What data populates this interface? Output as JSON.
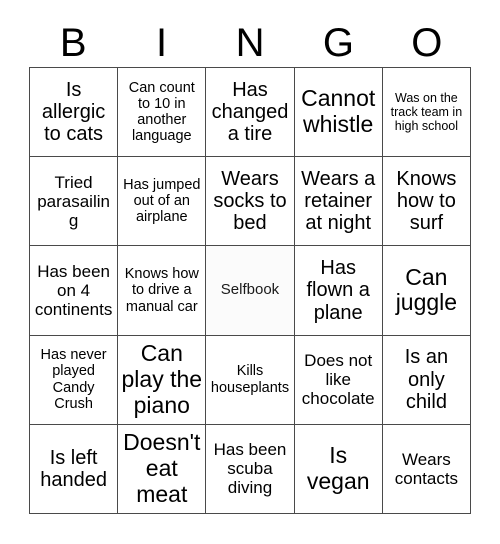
{
  "card": {
    "title": "BINGO",
    "header_letters": [
      "B",
      "I",
      "N",
      "G",
      "O"
    ],
    "grid_size": "5x5",
    "free_space_index": 12,
    "colors": {
      "border": "#4a4a4a",
      "text": "#000000",
      "background": "#ffffff",
      "free_space_background": "#fbfbfb"
    },
    "cells": [
      {
        "text": "Is allergic to cats",
        "size": "lg",
        "free": false
      },
      {
        "text": "Can count to 10 in another language",
        "size": "sm",
        "free": false
      },
      {
        "text": "Has changed a tire",
        "size": "lg",
        "free": false
      },
      {
        "text": "Cannot whistle",
        "size": "xl",
        "free": false
      },
      {
        "text": "Was on the track team in high school",
        "size": "xs",
        "free": false
      },
      {
        "text": "Tried parasailing",
        "size": "md",
        "free": false
      },
      {
        "text": "Has jumped out of an airplane",
        "size": "sm",
        "free": false
      },
      {
        "text": "Wears socks to bed",
        "size": "lg",
        "free": false
      },
      {
        "text": "Wears a retainer at night",
        "size": "lg",
        "free": false
      },
      {
        "text": "Knows how to surf",
        "size": "lg",
        "free": false
      },
      {
        "text": "Has been on 4 continents",
        "size": "md",
        "free": false
      },
      {
        "text": "Knows how to drive a manual car",
        "size": "sm",
        "free": false
      },
      {
        "text": "Selfbook",
        "size": "md",
        "free": true
      },
      {
        "text": "Has flown a plane",
        "size": "lg",
        "free": false
      },
      {
        "text": "Can juggle",
        "size": "xl",
        "free": false
      },
      {
        "text": "Has never played Candy Crush",
        "size": "sm",
        "free": false
      },
      {
        "text": "Can play the piano",
        "size": "xl",
        "free": false
      },
      {
        "text": "Kills houseplants",
        "size": "sm",
        "free": false
      },
      {
        "text": "Does not like chocolate",
        "size": "md",
        "free": false
      },
      {
        "text": "Is an only child",
        "size": "lg",
        "free": false
      },
      {
        "text": "Is left handed",
        "size": "lg",
        "free": false
      },
      {
        "text": "Doesn't eat meat",
        "size": "xl",
        "free": false
      },
      {
        "text": "Has been scuba diving",
        "size": "md",
        "free": false
      },
      {
        "text": "Is vegan",
        "size": "xl",
        "free": false
      },
      {
        "text": "Wears contacts",
        "size": "md",
        "free": false
      }
    ]
  }
}
